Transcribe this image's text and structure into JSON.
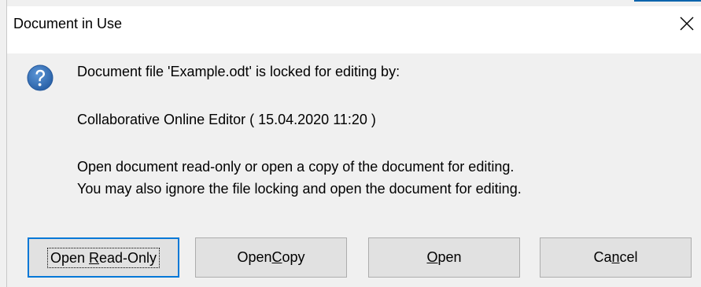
{
  "dialog": {
    "title": "Document in Use",
    "close_icon": "close-icon",
    "accent_color": "#0078d7"
  },
  "message": {
    "icon": "question-icon",
    "icon_color": "#2f6db3",
    "line1": "Document file 'Example.odt' is locked for editing by:",
    "line2": "Collaborative Online Editor ( 15.04.2020 11:20 )",
    "line3": "Open document read-only or open a copy of the document for editing.",
    "line4": "You may also ignore the file locking and open the document for editing."
  },
  "buttons": {
    "read_only": {
      "before": "Open ",
      "mnemonic": "R",
      "after": "ead-Only",
      "is_default": true
    },
    "copy": {
      "before": "Open ",
      "mnemonic": "C",
      "after": "opy"
    },
    "open": {
      "before": "",
      "mnemonic": "O",
      "after": "pen"
    },
    "cancel": {
      "before": "Ca",
      "mnemonic": "n",
      "after": "cel"
    }
  }
}
